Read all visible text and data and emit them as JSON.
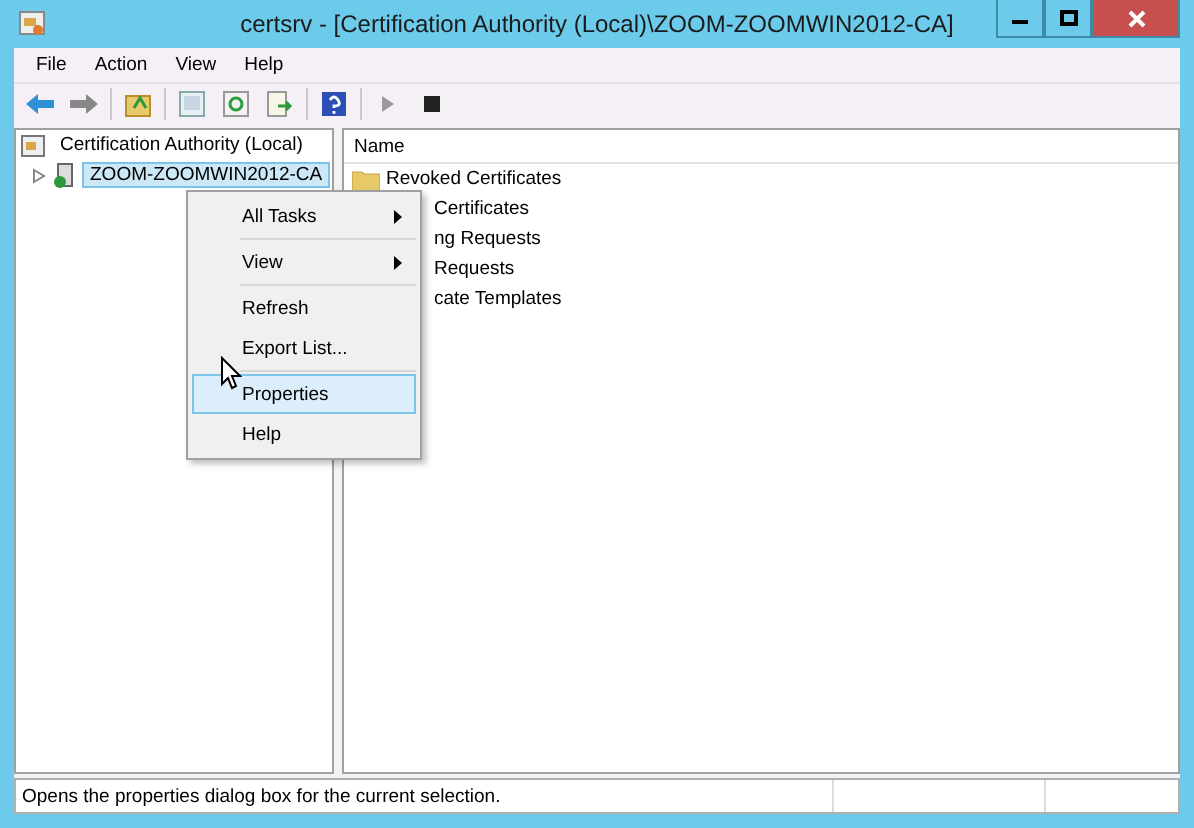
{
  "window": {
    "title": "certsrv - [Certification Authority (Local)\\ZOOM-ZOOMWIN2012-CA]"
  },
  "menu_bar": [
    "File",
    "Action",
    "View",
    "Help"
  ],
  "tree": {
    "label": "Certification Authority (Local)",
    "children": [
      {
        "label": "ZOOM-ZOOMWIN2012-CA",
        "expanded": false,
        "selected": true
      }
    ]
  },
  "list": {
    "columns": [
      "Name"
    ],
    "rows": [
      {
        "name": "Revoked Certificates",
        "kind": "full"
      },
      {
        "name": "Certificates",
        "kind": "partial"
      },
      {
        "name": "ng Requests",
        "kind": "partial"
      },
      {
        "name": "Requests",
        "kind": "partial"
      },
      {
        "name": "cate Templates",
        "kind": "partial"
      }
    ]
  },
  "context_menu": {
    "groups": [
      [
        {
          "label": "All Tasks",
          "submenu": true,
          "selected": false
        }
      ],
      [
        {
          "label": "View",
          "submenu": true,
          "selected": false
        }
      ],
      [
        {
          "label": "Refresh",
          "submenu": false,
          "selected": false
        },
        {
          "label": "Export List...",
          "submenu": false,
          "selected": false
        }
      ],
      [
        {
          "label": "Properties",
          "submenu": false,
          "selected": true
        },
        {
          "label": "Help",
          "submenu": false,
          "selected": false
        }
      ]
    ]
  },
  "status_bar": {
    "text": "Opens the properties dialog box for the current selection."
  }
}
